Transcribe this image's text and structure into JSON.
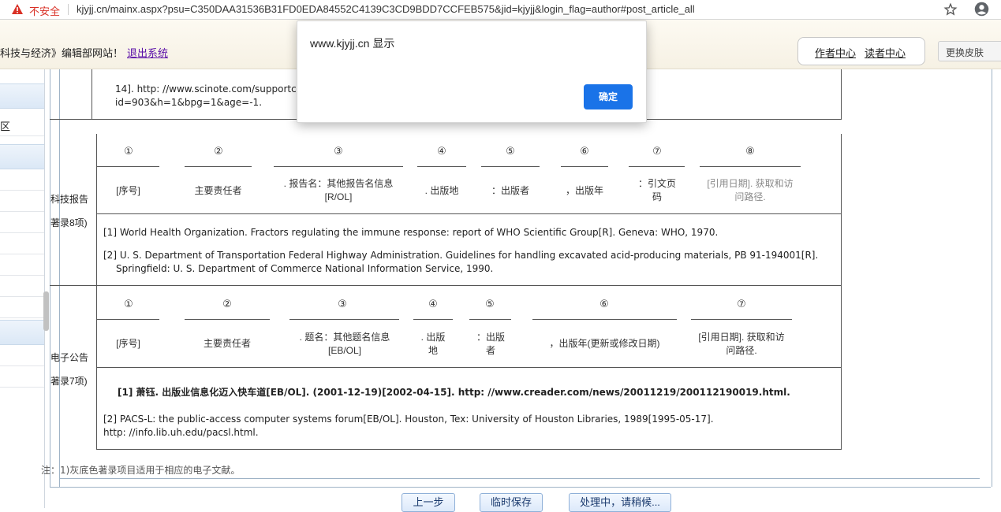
{
  "browser": {
    "security_label": "不安全",
    "url": "kjyjj.cn/mainx.aspx?psu=C350DAA31536B31FD0EDA84552C4139C3CD9BDD7CCFEB575&jid=kjyjj&login_flag=author#post_article_all"
  },
  "header": {
    "welcome_text": "科技与经济》编辑部网站！",
    "logout_link": "退出系统",
    "author_center": "作者中心",
    "reader_center": "读者中心",
    "skin_select": "更换皮肤"
  },
  "sidebar": {
    "visible_text": "区"
  },
  "top_fragment": {
    "line1": "14]. http: //www.scinote.com/supportc",
    "line2": "id=903&h=1&bpg=1&age=-1."
  },
  "report_section": {
    "label_1": "科技报告",
    "label_2": "著录8项)",
    "numbers": [
      "①",
      "②",
      "③",
      "④",
      "⑤",
      "⑥",
      "⑦",
      "⑧"
    ],
    "fields": [
      "[序号]",
      "主要责任者",
      ". 报告名：其他报告名信息[R/OL]",
      ". 出版地",
      "：出版者",
      "，出版年",
      "：引文页码",
      "[引用日期]. 获取和访问路径."
    ],
    "example_1": "[1] World Health Organization. Fractors regulating the immune response: report of WHO Scientific Group[R]. Geneva: WHO, 1970.",
    "example_2_line1": "[2] U. S. Department of Transportation Federal Highway Administration. Guidelines for handling excavated acid-producing materials, PB 91-194001[R].",
    "example_2_line2": "Springfield: U. S. Department of Commerce National Information Service, 1990."
  },
  "electronic_section": {
    "label_1": "电子公告",
    "label_2": "著录7项)",
    "numbers": [
      "①",
      "②",
      "③",
      "④",
      "⑤",
      "⑥",
      "⑦"
    ],
    "fields": [
      "[序号]",
      "主要责任者",
      ". 题名：其他题名信息[EB/OL]",
      ". 出版地",
      "：出版者",
      "，出版年(更新或修改日期)",
      "[引用日期]. 获取和访问路径."
    ],
    "example_1": "[1] 萧钰. 出版业信息化迈入快车道[EB/OL]. (2001-12-19)[2002-04-15]. http: //www.creader.com/news/20011219/200112190019.html.",
    "example_2_line1": "[2] PACS-L: the public-access computer systems forum[EB/OL]. Houston, Tex: University of Houston Libraries, 1989[1995-05-17].",
    "example_2_line2": "http: //info.lib.uh.edu/pacsl.html."
  },
  "footnote": "注：1)灰底色著录项目适用于相应的电子文献。",
  "buttons": {
    "prev": "上一步",
    "save": "临时保存",
    "processing": "处理中，请稍候..."
  },
  "dialog": {
    "title": "www.kjyjj.cn 显示",
    "ok": "确定"
  }
}
